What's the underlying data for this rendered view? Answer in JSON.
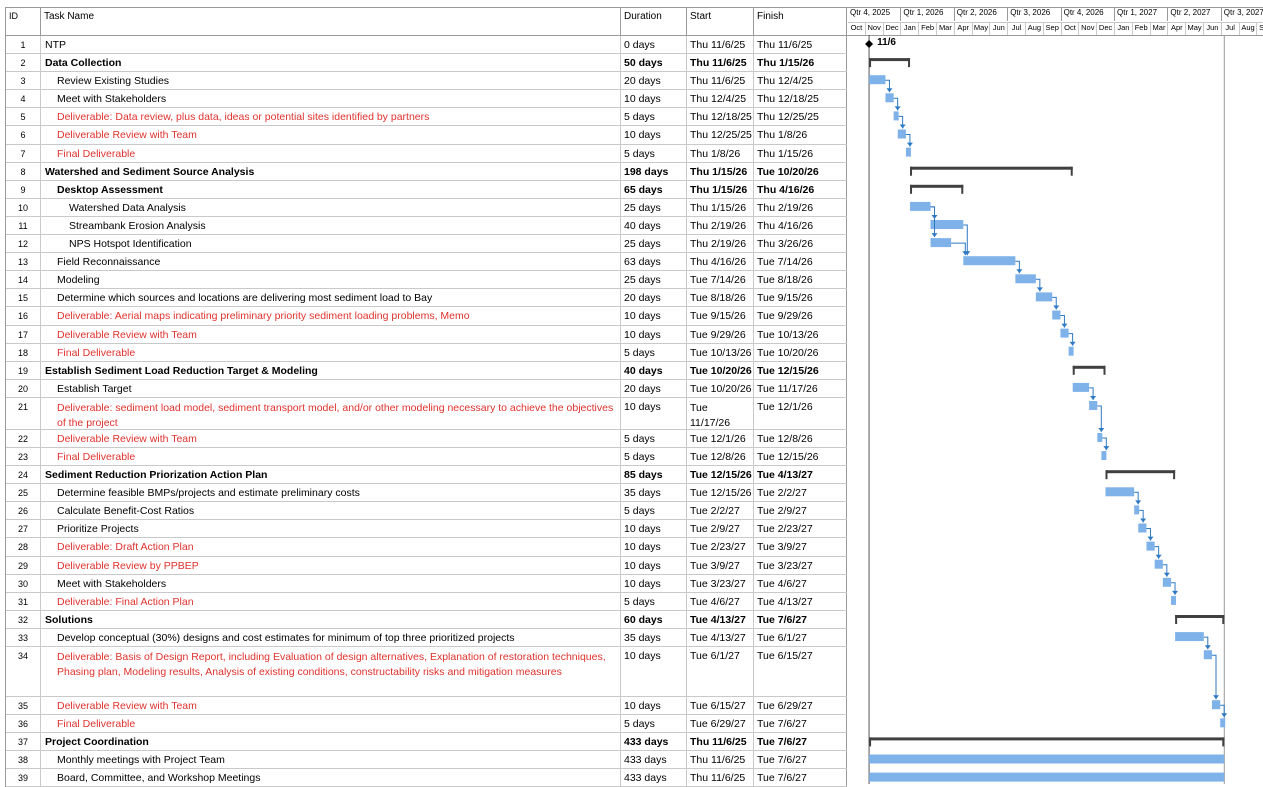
{
  "columns": {
    "id": "ID",
    "name": "Task Name",
    "duration": "Duration",
    "start": "Start",
    "finish": "Finish"
  },
  "timescale": {
    "quarters": [
      "Qtr 4, 2025",
      "Qtr 1, 2026",
      "Qtr 2, 2026",
      "Qtr 3, 2026",
      "Qtr 4, 2026",
      "Qtr 1, 2027",
      "Qtr 2, 2027",
      "Qtr 3, 2027"
    ],
    "months": [
      "Oct",
      "Nov",
      "Dec",
      "Jan",
      "Feb",
      "Mar",
      "Apr",
      "May",
      "Jun",
      "Jul",
      "Aug",
      "Sep",
      "Oct",
      "Nov",
      "Dec",
      "Jan",
      "Feb",
      "Mar",
      "Apr",
      "May",
      "Jun",
      "Jul",
      "Aug",
      "Sep"
    ]
  },
  "milestone_label": "11/6",
  "colors": {
    "bar": "#7fb2e8",
    "summary": "#404040",
    "link": "#2f7ac4",
    "red_text": "#e0322d",
    "grid": "#c9c9c9"
  },
  "tasks": [
    {
      "id": "1",
      "name": "NTP",
      "duration": "0 days",
      "start": "Thu 11/6/25",
      "finish": "Thu 11/6/25",
      "level": 0,
      "style": "normal",
      "type": "milestone",
      "s": "2025-11-06",
      "f": "2025-11-06"
    },
    {
      "id": "2",
      "name": "Data Collection",
      "duration": "50 days",
      "start": "Thu 11/6/25",
      "finish": "Thu 1/15/26",
      "level": 0,
      "style": "bold",
      "type": "summary",
      "s": "2025-11-06",
      "f": "2026-01-15"
    },
    {
      "id": "3",
      "name": "Review Existing Studies",
      "duration": "20 days",
      "start": "Thu 11/6/25",
      "finish": "Thu 12/4/25",
      "level": 1,
      "style": "normal",
      "type": "task",
      "s": "2025-11-06",
      "f": "2025-12-04"
    },
    {
      "id": "4",
      "name": "Meet with Stakeholders",
      "duration": "10 days",
      "start": "Thu 12/4/25",
      "finish": "Thu 12/18/25",
      "level": 1,
      "style": "normal",
      "type": "task",
      "s": "2025-12-04",
      "f": "2025-12-18"
    },
    {
      "id": "5",
      "name": "Deliverable: Data review, plus data, ideas or potential sites identified by partners",
      "duration": "5 days",
      "start": "Thu 12/18/25",
      "finish": "Thu 12/25/25",
      "level": 1,
      "style": "red",
      "type": "task",
      "s": "2025-12-18",
      "f": "2025-12-25"
    },
    {
      "id": "6",
      "name": "Deliverable Review with Team",
      "duration": "10 days",
      "start": "Thu 12/25/25",
      "finish": "Thu 1/8/26",
      "level": 1,
      "style": "red",
      "type": "task",
      "s": "2025-12-25",
      "f": "2026-01-08"
    },
    {
      "id": "7",
      "name": "Final Deliverable",
      "duration": "5 days",
      "start": "Thu 1/8/26",
      "finish": "Thu 1/15/26",
      "level": 1,
      "style": "red",
      "type": "task",
      "s": "2026-01-08",
      "f": "2026-01-15"
    },
    {
      "id": "8",
      "name": "Watershed and Sediment Source Analysis",
      "duration": "198 days",
      "start": "Thu 1/15/26",
      "finish": "Tue 10/20/26",
      "level": 0,
      "style": "bold",
      "type": "summary",
      "s": "2026-01-15",
      "f": "2026-10-20"
    },
    {
      "id": "9",
      "name": "Desktop Assessment",
      "duration": "65 days",
      "start": "Thu 1/15/26",
      "finish": "Thu 4/16/26",
      "level": 1,
      "style": "bold",
      "type": "summary",
      "s": "2026-01-15",
      "f": "2026-04-16"
    },
    {
      "id": "10",
      "name": "Watershed Data Analysis",
      "duration": "25 days",
      "start": "Thu 1/15/26",
      "finish": "Thu 2/19/26",
      "level": 2,
      "style": "normal",
      "type": "task",
      "s": "2026-01-15",
      "f": "2026-02-19"
    },
    {
      "id": "11",
      "name": "Streambank Erosion Analysis",
      "duration": "40 days",
      "start": "Thu 2/19/26",
      "finish": "Thu 4/16/26",
      "level": 2,
      "style": "normal",
      "type": "task",
      "s": "2026-02-19",
      "f": "2026-04-16"
    },
    {
      "id": "12",
      "name": "NPS Hotspot Identification",
      "duration": "25 days",
      "start": "Thu 2/19/26",
      "finish": "Thu 3/26/26",
      "level": 2,
      "style": "normal",
      "type": "task",
      "s": "2026-02-19",
      "f": "2026-03-26"
    },
    {
      "id": "13",
      "name": "Field Reconnaissance",
      "duration": "63 days",
      "start": "Thu 4/16/26",
      "finish": "Tue 7/14/26",
      "level": 1,
      "style": "normal",
      "type": "task",
      "s": "2026-04-16",
      "f": "2026-07-14"
    },
    {
      "id": "14",
      "name": "Modeling",
      "duration": "25 days",
      "start": "Tue 7/14/26",
      "finish": "Tue 8/18/26",
      "level": 1,
      "style": "normal",
      "type": "task",
      "s": "2026-07-14",
      "f": "2026-08-18"
    },
    {
      "id": "15",
      "name": "Determine which sources and locations are delivering most sediment load to Bay",
      "duration": "20 days",
      "start": "Tue 8/18/26",
      "finish": "Tue 9/15/26",
      "level": 1,
      "style": "normal",
      "type": "task",
      "s": "2026-08-18",
      "f": "2026-09-15"
    },
    {
      "id": "16",
      "name": "Deliverable: Aerial maps indicating preliminary priority sediment loading problems, Memo",
      "duration": "10 days",
      "start": "Tue 9/15/26",
      "finish": "Tue 9/29/26",
      "level": 1,
      "style": "red",
      "type": "task",
      "s": "2026-09-15",
      "f": "2026-09-29"
    },
    {
      "id": "17",
      "name": "Deliverable Review with Team",
      "duration": "10 days",
      "start": "Tue 9/29/26",
      "finish": "Tue 10/13/26",
      "level": 1,
      "style": "red",
      "type": "task",
      "s": "2026-09-29",
      "f": "2026-10-13"
    },
    {
      "id": "18",
      "name": "Final Deliverable",
      "duration": "5 days",
      "start": "Tue 10/13/26",
      "finish": "Tue 10/20/26",
      "level": 1,
      "style": "red",
      "type": "task",
      "s": "2026-10-13",
      "f": "2026-10-20"
    },
    {
      "id": "19",
      "name": "Establish Sediment Load Reduction Target & Modeling",
      "duration": "40 days",
      "start": "Tue 10/20/26",
      "finish": "Tue 12/15/26",
      "level": 0,
      "style": "bold",
      "type": "summary",
      "s": "2026-10-20",
      "f": "2026-12-15"
    },
    {
      "id": "20",
      "name": "Establish Target",
      "duration": "20 days",
      "start": "Tue 10/20/26",
      "finish": "Tue 11/17/26",
      "level": 1,
      "style": "normal",
      "type": "task",
      "s": "2026-10-20",
      "f": "2026-11-17"
    },
    {
      "id": "21",
      "name": "Deliverable: sediment load model, sediment transport model, and/or other modeling necessary to achieve the objectives of the project",
      "duration": "10 days",
      "start": "Tue 11/17/26",
      "finish": "Tue 12/1/26",
      "level": 1,
      "style": "red",
      "type": "task",
      "s": "2026-11-17",
      "f": "2026-12-01"
    },
    {
      "id": "22",
      "name": "Deliverable Review with Team",
      "duration": "5 days",
      "start": "Tue 12/1/26",
      "finish": "Tue 12/8/26",
      "level": 1,
      "style": "red",
      "type": "task",
      "s": "2026-12-01",
      "f": "2026-12-08"
    },
    {
      "id": "23",
      "name": "Final Deliverable",
      "duration": "5 days",
      "start": "Tue 12/8/26",
      "finish": "Tue 12/15/26",
      "level": 1,
      "style": "red",
      "type": "task",
      "s": "2026-12-08",
      "f": "2026-12-15"
    },
    {
      "id": "24",
      "name": "Sediment Reduction Priorization Action Plan",
      "duration": "85 days",
      "start": "Tue 12/15/26",
      "finish": "Tue 4/13/27",
      "level": 0,
      "style": "bold",
      "type": "summary",
      "s": "2026-12-15",
      "f": "2027-04-13"
    },
    {
      "id": "25",
      "name": "Determine feasible BMPs/projects and estimate preliminary costs",
      "duration": "35 days",
      "start": "Tue 12/15/26",
      "finish": "Tue 2/2/27",
      "level": 1,
      "style": "normal",
      "type": "task",
      "s": "2026-12-15",
      "f": "2027-02-02"
    },
    {
      "id": "26",
      "name": "Calculate Benefit-Cost Ratios",
      "duration": "5 days",
      "start": "Tue 2/2/27",
      "finish": "Tue 2/9/27",
      "level": 1,
      "style": "normal",
      "type": "task",
      "s": "2027-02-02",
      "f": "2027-02-09"
    },
    {
      "id": "27",
      "name": "Prioritize Projects",
      "duration": "10 days",
      "start": "Tue 2/9/27",
      "finish": "Tue 2/23/27",
      "level": 1,
      "style": "normal",
      "type": "task",
      "s": "2027-02-09",
      "f": "2027-02-23"
    },
    {
      "id": "28",
      "name": "Deliverable: Draft Action Plan",
      "duration": "10 days",
      "start": "Tue 2/23/27",
      "finish": "Tue 3/9/27",
      "level": 1,
      "style": "red",
      "type": "task",
      "s": "2027-02-23",
      "f": "2027-03-09"
    },
    {
      "id": "29",
      "name": "Deliverable Review by PPBEP",
      "duration": "10 days",
      "start": "Tue 3/9/27",
      "finish": "Tue 3/23/27",
      "level": 1,
      "style": "red",
      "type": "task",
      "s": "2027-03-09",
      "f": "2027-03-23"
    },
    {
      "id": "30",
      "name": "Meet with Stakeholders",
      "duration": "10 days",
      "start": "Tue 3/23/27",
      "finish": "Tue 4/6/27",
      "level": 1,
      "style": "normal",
      "type": "task",
      "s": "2027-03-23",
      "f": "2027-04-06"
    },
    {
      "id": "31",
      "name": "Deliverable: Final Action Plan",
      "duration": "5 days",
      "start": "Tue 4/6/27",
      "finish": "Tue 4/13/27",
      "level": 1,
      "style": "red",
      "type": "task",
      "s": "2027-04-06",
      "f": "2027-04-13"
    },
    {
      "id": "32",
      "name": "Solutions",
      "duration": "60 days",
      "start": "Tue 4/13/27",
      "finish": "Tue 7/6/27",
      "level": 0,
      "style": "bold",
      "type": "summary",
      "s": "2027-04-13",
      "f": "2027-07-06"
    },
    {
      "id": "33",
      "name": "Develop conceptual (30%) designs and cost estimates for minimum of top three prioritized projects",
      "duration": "35 days",
      "start": "Tue 4/13/27",
      "finish": "Tue 6/1/27",
      "level": 1,
      "style": "normal",
      "type": "task",
      "s": "2027-04-13",
      "f": "2027-06-01"
    },
    {
      "id": "34",
      "name": "Deliverable: Basis of Design Report, including Evaluation of design alternatives, Explanation of restoration techniques, Phasing plan, Modeling results, Analysis of existing conditions, constructability risks and mitigation measures",
      "duration": "10 days",
      "start": "Tue 6/1/27",
      "finish": "Tue 6/15/27",
      "level": 1,
      "style": "red",
      "type": "task",
      "s": "2027-06-01",
      "f": "2027-06-15"
    },
    {
      "id": "35",
      "name": "Deliverable Review with Team",
      "duration": "10 days",
      "start": "Tue 6/15/27",
      "finish": "Tue 6/29/27",
      "level": 1,
      "style": "red",
      "type": "task",
      "s": "2027-06-15",
      "f": "2027-06-29"
    },
    {
      "id": "36",
      "name": "Final Deliverable",
      "duration": "5 days",
      "start": "Tue 6/29/27",
      "finish": "Tue 7/6/27",
      "level": 1,
      "style": "red",
      "type": "task",
      "s": "2027-06-29",
      "f": "2027-07-06"
    },
    {
      "id": "37",
      "name": "Project Coordination",
      "duration": "433 days",
      "start": "Thu 11/6/25",
      "finish": "Tue 7/6/27",
      "level": 0,
      "style": "bold",
      "type": "summary",
      "s": "2025-11-06",
      "f": "2027-07-06"
    },
    {
      "id": "38",
      "name": "Monthly meetings with Project Team",
      "duration": "433 days",
      "start": "Thu 11/6/25",
      "finish": "Tue 7/6/27",
      "level": 1,
      "style": "normal",
      "type": "task",
      "s": "2025-11-06",
      "f": "2027-07-06"
    },
    {
      "id": "39",
      "name": "Board, Committee, and Workshop Meetings",
      "duration": "433 days",
      "start": "Thu 11/6/25",
      "finish": "Tue 7/6/27",
      "level": 1,
      "style": "normal",
      "type": "task",
      "s": "2025-11-06",
      "f": "2027-07-06"
    }
  ]
}
